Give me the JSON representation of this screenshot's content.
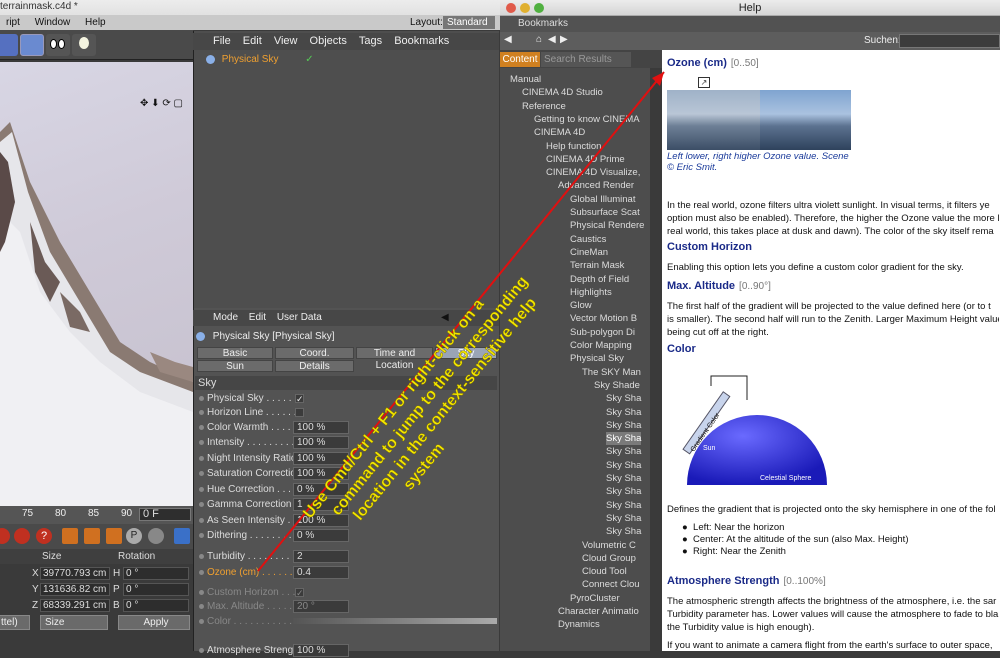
{
  "c4d": {
    "window_title": "terrainmask.c4d *",
    "menu": [
      "ript",
      "Window",
      "Help"
    ],
    "layout_label": "Layout:",
    "layout_value": "Standard",
    "timeline": {
      "ticks": [
        "75",
        "80",
        "85",
        "90"
      ],
      "frame": "0 F"
    },
    "coord_headers": {
      "size": "Size",
      "rotation": "Rotation"
    },
    "coords": [
      {
        "axis": "X",
        "size": "39770.793 cm",
        "rot_axis": "H",
        "rot": "0 °"
      },
      {
        "axis": "Y",
        "size": "131636.82 cm",
        "rot_axis": "P",
        "rot": "0 °"
      },
      {
        "axis": "Z",
        "size": "68339.291 cm",
        "rot_axis": "B",
        "rot": "0 °"
      }
    ],
    "coord_mode": "ttel)",
    "coord_size_mode": "Size",
    "apply_label": "Apply"
  },
  "objects": {
    "menu": [
      "File",
      "Edit",
      "View",
      "Objects",
      "Tags",
      "Bookmarks"
    ],
    "item": "Physical Sky"
  },
  "attributes": {
    "menu": [
      "Mode",
      "Edit",
      "User Data"
    ],
    "title": "Physical Sky [Physical Sky]",
    "tabs_row1": [
      "Basic",
      "Coord.",
      "Time and Location",
      "Sky"
    ],
    "tabs_row2": [
      "Sun",
      "Details"
    ],
    "section": "Sky",
    "rows": [
      {
        "label": "Physical Sky . . . . . . .",
        "check": "✓"
      },
      {
        "label": "Horizon Line . . . . . . .",
        "check": ""
      },
      {
        "label": "Color Warmth . . . . . .",
        "value": "100 %"
      },
      {
        "label": "Intensity . . . . . . . . .",
        "value": "100 %"
      },
      {
        "label": "Night Intensity Ratio",
        "value": "100 %"
      },
      {
        "label": "Saturation Correction",
        "value": "100 %"
      },
      {
        "label": "Hue Correction . . . . .",
        "value": "0 %"
      },
      {
        "label": "Gamma Correction . .",
        "value": "1"
      },
      {
        "label": "As Seen Intensity . . .",
        "value": "100 %"
      },
      {
        "label": "Dithering . . . . . . . . .",
        "value": "0 %"
      },
      {
        "label": "Turbidity . . . . . . . . .",
        "value": "2"
      },
      {
        "label": "Ozone (cm) . . . . . . .",
        "value": "0.4"
      },
      {
        "label": "Custom Horizon . . . .",
        "check": "✓"
      },
      {
        "label": "Max. Altitude . . . . . .",
        "value": "20 °"
      },
      {
        "label": "Color . . . . . . . . . . . .",
        "value": ""
      },
      {
        "label": "Atmosphere Strength",
        "value": "100 %"
      }
    ]
  },
  "help": {
    "window_title": "Help",
    "bookmarks_label": "Bookmarks",
    "search_label": "Suchen:",
    "tab_content": "Content",
    "tab_search": "Search Results",
    "tree": [
      {
        "label": "Manual",
        "indent": 0
      },
      {
        "label": "CINEMA 4D Studio",
        "indent": 1
      },
      {
        "label": "Reference",
        "indent": 1
      },
      {
        "label": "Getting to know CINEMA",
        "indent": 2
      },
      {
        "label": "CINEMA 4D",
        "indent": 2
      },
      {
        "label": "Help function",
        "indent": 3
      },
      {
        "label": "CINEMA 4D Prime",
        "indent": 3
      },
      {
        "label": "CINEMA 4D Visualize,",
        "indent": 3
      },
      {
        "label": "Advanced Render",
        "indent": 4
      },
      {
        "label": "Global Illuminat",
        "indent": 5
      },
      {
        "label": "Subsurface Scat",
        "indent": 5
      },
      {
        "label": "Physical Rendere",
        "indent": 5
      },
      {
        "label": "Caustics",
        "indent": 5
      },
      {
        "label": "CineMan",
        "indent": 5
      },
      {
        "label": "Terrain Mask",
        "indent": 5
      },
      {
        "label": "Depth of Field",
        "indent": 5
      },
      {
        "label": "Highlights",
        "indent": 5
      },
      {
        "label": "Glow",
        "indent": 5
      },
      {
        "label": "Vector Motion B",
        "indent": 5
      },
      {
        "label": "Sub-polygon Di",
        "indent": 5
      },
      {
        "label": "Color Mapping",
        "indent": 5
      },
      {
        "label": "Physical Sky",
        "indent": 5
      },
      {
        "label": "The SKY Man",
        "indent": 6
      },
      {
        "label": "Sky Shade",
        "indent": 7
      },
      {
        "label": "Sky Sha",
        "indent": 8
      },
      {
        "label": "Sky Sha",
        "indent": 8
      },
      {
        "label": "Sky Sha",
        "indent": 8
      },
      {
        "label": "Sky Sha",
        "indent": 8,
        "selected": true
      },
      {
        "label": "Sky Sha",
        "indent": 8
      },
      {
        "label": "Sky Sha",
        "indent": 8
      },
      {
        "label": "Sky Sha",
        "indent": 8
      },
      {
        "label": "Sky Sha",
        "indent": 8
      },
      {
        "label": "Sky Sha",
        "indent": 8
      },
      {
        "label": "Sky Sha",
        "indent": 8
      },
      {
        "label": "Sky Sha",
        "indent": 8
      },
      {
        "label": "Volumetric C",
        "indent": 6
      },
      {
        "label": "Cloud Group",
        "indent": 6
      },
      {
        "label": "Cloud Tool",
        "indent": 6
      },
      {
        "label": "Connect Clou",
        "indent": 6
      },
      {
        "label": "PyroCluster",
        "indent": 5
      },
      {
        "label": "Character Animatio",
        "indent": 4
      },
      {
        "label": "Dynamics",
        "indent": 4
      }
    ],
    "ozone_title": "Ozone (cm)",
    "ozone_range": "[0..50]",
    "caption_1": "Left lower, right higher Ozone value. Scene",
    "caption_2": "© Eric Smit.",
    "para_1": "In the real world, ozone filters ultra violett sunlight. In visual terms, it filters ye",
    "para_2": "option must also be enabled). Therefore, the higher the Ozone value the more l",
    "para_3": "real world, this takes place at dusk and dawn). The color of the sky itself rema",
    "custom_horizon_title": "Custom Horizon",
    "custom_horizon_text": "Enabling this option lets you define a custom color gradient for the sky.",
    "max_alt_title": "Max. Altitude",
    "max_alt_range": "[0..90°]",
    "max_alt_1": "The first half of the gradient will be projected to the value defined here (or to t",
    "max_alt_2": "is smaller). The second half will run to the Zenith. Larger Maximum Height values",
    "max_alt_3": "being cut off at the right.",
    "color_title": "Color",
    "diagram_gradient": "Gradient Color",
    "diagram_sun": "Sun",
    "diagram_sphere": "Celestial Sphere",
    "gradient_text": "Defines the gradient that is projected onto the sky hemisphere in one of the fol",
    "bullets": [
      "Left: Near the horizon",
      "Center: At the altitude of the sun (also Max. Height)",
      "Right: Near the Zenith"
    ],
    "atmo_title": "Atmosphere Strength",
    "atmo_range": "[0..100%]",
    "atmo_1": "The atmospheric strength affects the brightness of the atmosphere, i.e. the sar",
    "atmo_2": "Turbidity parameter has. Lower values will cause the atmosphere to fade to bla",
    "atmo_3": "the Turbidity value is high enough).",
    "atmo_4": "If you want to animate a camera flight from the earth's surface to outer space,"
  },
  "annotation": {
    "lines": [
      "Use Cmd/Ctrl + F1 or right-click on a",
      "command to jump to the corresponding",
      "location in the context-sensitive help",
      "system"
    ],
    "color": "#f2e600",
    "arrow_color": "#e01010"
  }
}
